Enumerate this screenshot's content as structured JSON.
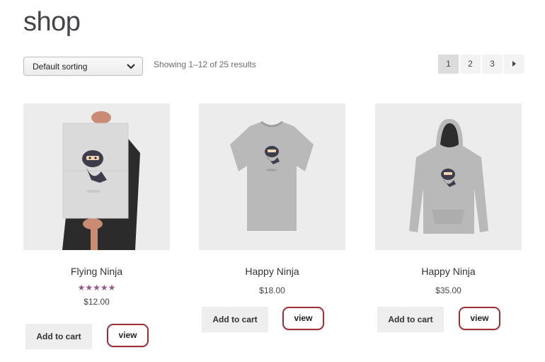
{
  "header": {
    "title": "shop"
  },
  "toolbar": {
    "sort_selected": "Default sorting",
    "result_count": "Showing 1–12 of 25 results"
  },
  "pagination": {
    "pages": [
      "1",
      "2",
      "3"
    ],
    "current": "1"
  },
  "products": [
    {
      "name": "Flying Ninja",
      "rating": 5,
      "rating_stars": "★★★★★",
      "price": "$12.00",
      "add_to_cart": "Add to cart",
      "view": "view",
      "image": "poster"
    },
    {
      "name": "Happy Ninja",
      "price": "$18.00",
      "add_to_cart": "Add to cart",
      "view": "view",
      "image": "t-shirt"
    },
    {
      "name": "Happy Ninja",
      "price": "$35.00",
      "add_to_cart": "Add to cart",
      "view": "view",
      "image": "hoodie"
    }
  ],
  "colors": {
    "accent_rating": "#96588a",
    "view_border": "#9f2f37"
  }
}
